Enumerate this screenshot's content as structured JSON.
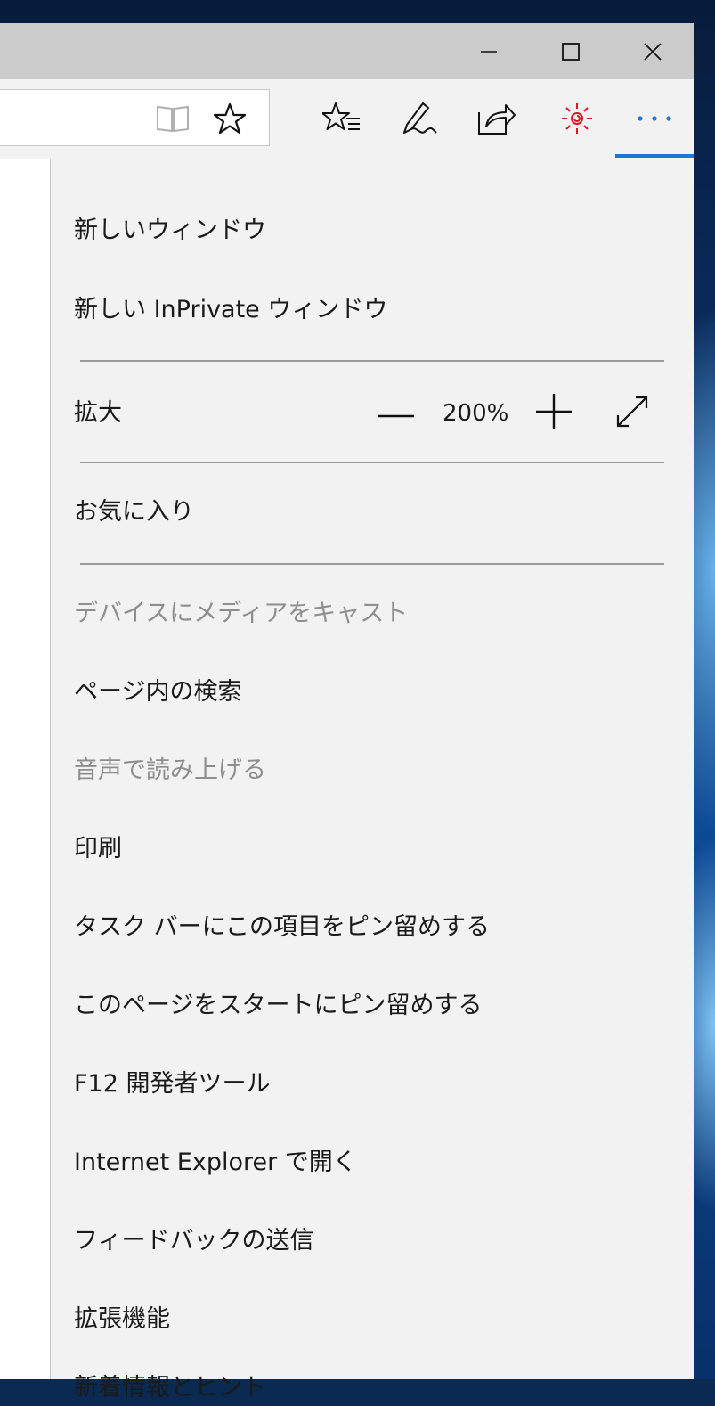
{
  "colors": {
    "accent": "#1e78d2",
    "menu_background": "#f2f2f2",
    "titlebar": "#cbcbcb",
    "disabled_text": "#8e8e8e",
    "hub_icon_red": "#e81123"
  },
  "window_controls": {
    "minimize_icon": "minimize-icon",
    "maximize_icon": "maximize-icon",
    "close_icon": "close-icon"
  },
  "toolbar": {
    "icons": [
      "reading-view-icon",
      "favorite-star-icon",
      "favorites-hub-icon",
      "web-note-icon",
      "share-icon",
      "extension-icon",
      "more-icon"
    ]
  },
  "menu": {
    "new_window": "新しいウィンドウ",
    "new_inprivate": "新しい InPrivate ウィンドウ",
    "zoom_label": "拡大",
    "zoom_value": "200%",
    "favorites": "お気に入り",
    "cast": "デバイスにメディアをキャスト",
    "find_on_page": "ページ内の検索",
    "read_aloud": "音声で読み上げる",
    "print": "印刷",
    "pin_taskbar": "タスク バーにこの項目をピン留めする",
    "pin_start": "このページをスタートにピン留めする",
    "dev_tools": "F12 開発者ツール",
    "open_ie": "Internet Explorer で開く",
    "feedback": "フィードバックの送信",
    "extensions": "拡張機能",
    "whats_new": "新着情報とヒント"
  }
}
